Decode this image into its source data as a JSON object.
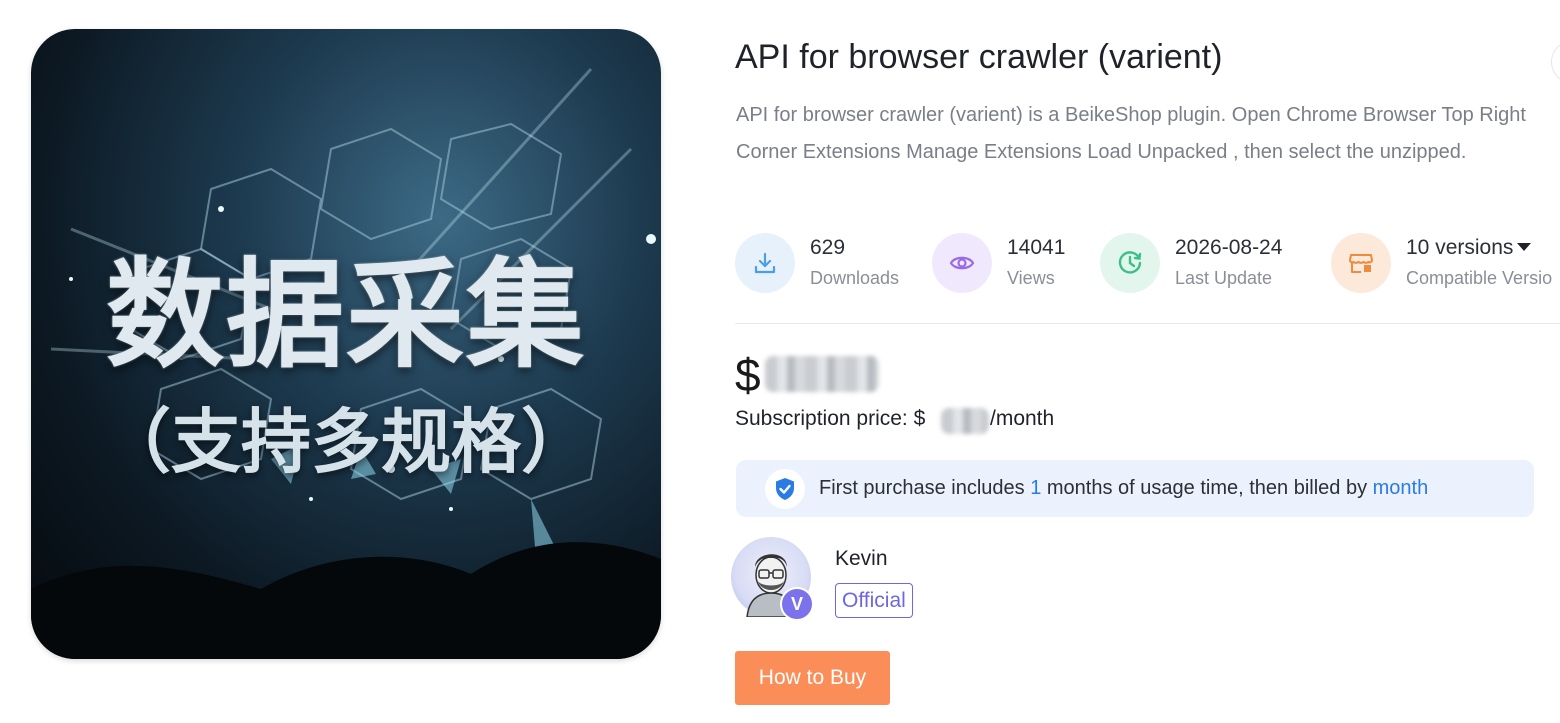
{
  "hero": {
    "title": "数据采集",
    "subtitle": "（支持多规格）"
  },
  "product": {
    "title": "API for browser crawler (varient)",
    "description": "API for browser crawler (varient) is a BeikeShop plugin. Open Chrome Browser Top Right Corner Extensions Manage Extensions Load Unpacked , then select the unzipped."
  },
  "stats": [
    {
      "icon": "download-icon",
      "value": "629",
      "label": "Downloads",
      "color": "#4a9fe8",
      "bg": "#e6f1fc"
    },
    {
      "icon": "eye-icon",
      "value": "14041",
      "label": "Views",
      "color": "#9a6ae8",
      "bg": "#f0e8fc"
    },
    {
      "icon": "clock-icon",
      "value": "2026-08-24",
      "label": "Last Update",
      "color": "#3cc088",
      "bg": "#e3f6ee"
    },
    {
      "icon": "shop-plugin-icon",
      "value": "10 versions",
      "label": "Compatible Versio",
      "color": "#f08a3c",
      "bg": "#fde9d9"
    }
  ],
  "price": {
    "symbol": "$",
    "subscription_prefix": "Subscription price: $",
    "subscription_suffix": "/month"
  },
  "notice": {
    "before": "First purchase includes ",
    "months": "1",
    "middle": " months of usage time, then billed by ",
    "period": "month"
  },
  "author": {
    "name": "Kevin",
    "badge": "V",
    "tag": "Official"
  },
  "actions": {
    "buy_label": "How to Buy"
  },
  "colors": {
    "accent_blue": "#2a7be4",
    "official_purple": "#6d66e8",
    "buy_orange": "#fb8d59"
  }
}
